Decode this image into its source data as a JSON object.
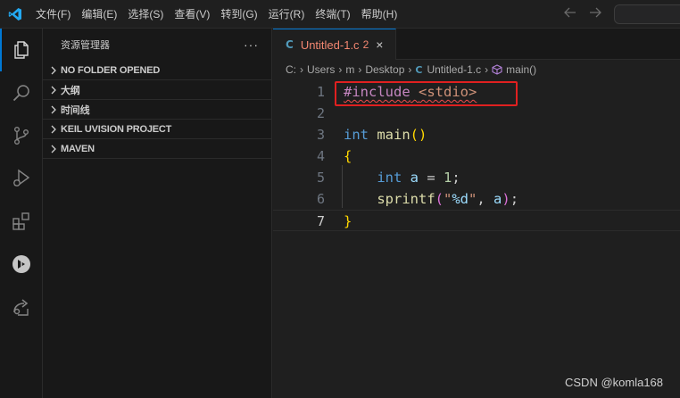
{
  "titlebar": {
    "menu": [
      "文件(F)",
      "编辑(E)",
      "选择(S)",
      "查看(V)",
      "转到(G)",
      "运行(R)",
      "终端(T)",
      "帮助(H)"
    ],
    "back_icon": "arrow-left-icon",
    "forward_icon": "arrow-right-icon"
  },
  "activitybar": {
    "items": [
      "explorer-icon",
      "search-icon",
      "source-control-icon",
      "run-debug-icon",
      "extensions-icon",
      "keil-icon",
      "remote-icon"
    ]
  },
  "sidebar": {
    "title": "资源管理器",
    "more": "···",
    "sections": [
      "NO FOLDER OPENED",
      "大纲",
      "时间线",
      "KEIL UVISION PROJECT",
      "MAVEN"
    ]
  },
  "tab": {
    "icon_letter": "C",
    "name": "Untitled-1.c",
    "problems": "2",
    "close": "×"
  },
  "breadcrumb": {
    "parts": [
      "C:",
      "Users",
      "m",
      "Desktop"
    ],
    "file": "Untitled-1.c",
    "symbol": "main()"
  },
  "editor": {
    "line_numbers": [
      "1",
      "2",
      "3",
      "4",
      "5",
      "6",
      "7"
    ],
    "current_line": "7",
    "tokens": {
      "include": "#include",
      "header": "<stdio>",
      "int": "int",
      "main": "main",
      "lparen": "(",
      "rparen": ")",
      "lbrace": "{",
      "rbrace": "}",
      "int2": "int",
      "a": "a",
      "eq": " = ",
      "one": "1",
      "semi": ";",
      "sprintf": "sprintf",
      "str_open": "\"",
      "fmt": "%d",
      "str_close": "\"",
      "comma": ", ",
      "a2": "a",
      "end": ";"
    }
  },
  "watermark": "CSDN @komla168",
  "colors": {
    "accent": "#0078d4",
    "error_box": "#e02020",
    "tab_error_text": "#f48771"
  }
}
